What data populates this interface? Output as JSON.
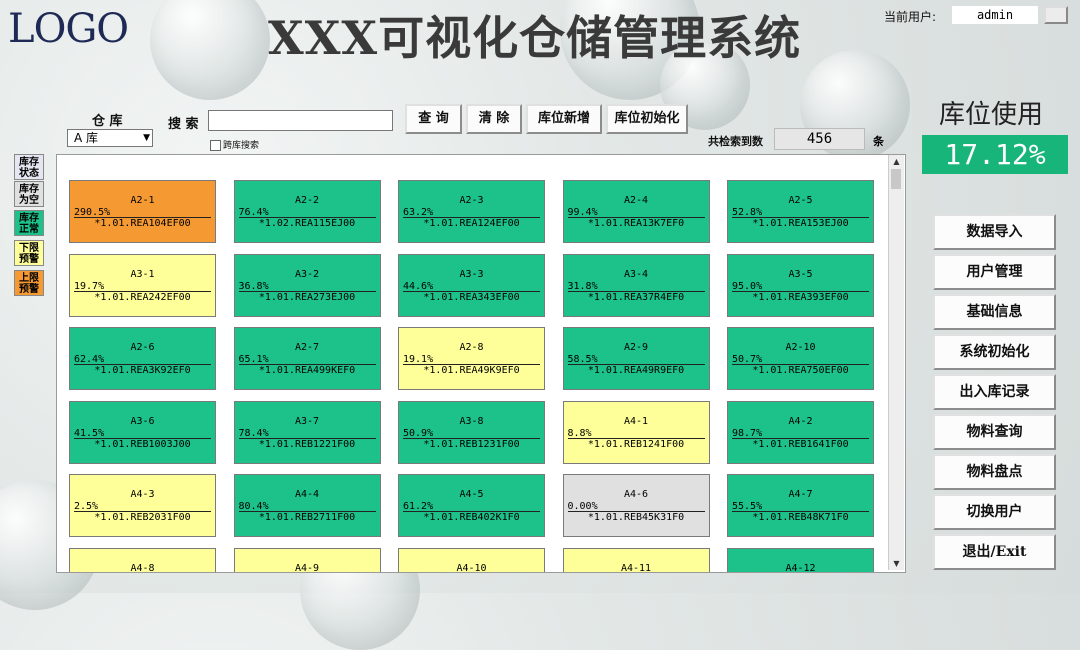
{
  "header": {
    "logo": "LOGO",
    "title": "XXX可视化仓储管理系统",
    "user_label": "当前用户:",
    "user_value": "admin"
  },
  "toolbar": {
    "warehouse_label": "仓 库",
    "warehouse_value": "A 库",
    "search_label": "搜 索",
    "search_value": "",
    "cross_search_label": "跨库搜索",
    "buttons": [
      "查 询",
      "清 除",
      "库位新增",
      "库位初始化"
    ],
    "count_label": "共检索到数",
    "count_value": "456",
    "count_unit": "条"
  },
  "usage": {
    "title": "库位使用",
    "value": "17.12%"
  },
  "legend": [
    {
      "label": "库存状态",
      "color": "#e6e6f2"
    },
    {
      "label": "库存为空",
      "color": "#e0e0e0"
    },
    {
      "label": "库存正常",
      "color": "#1cc28a"
    },
    {
      "label": "下限预警",
      "color": "#ffff99"
    },
    {
      "label": "上限预警",
      "color": "#f59a33"
    }
  ],
  "colors": {
    "normal": "#1cc28a",
    "low": "#ffff99",
    "high": "#f59a33",
    "empty": "#e0e0e0"
  },
  "cells": [
    {
      "loc": "A2-1",
      "pct": "290.5%",
      "code": "*1.01.REA104EF00",
      "status": "high"
    },
    {
      "loc": "A2-2",
      "pct": "76.4%",
      "code": "*1.02.REA115EJ00",
      "status": "normal"
    },
    {
      "loc": "A2-3",
      "pct": "63.2%",
      "code": "*1.01.REA124EF00",
      "status": "normal"
    },
    {
      "loc": "A2-4",
      "pct": "99.4%",
      "code": "*1.01.REA13K7EF0",
      "status": "normal"
    },
    {
      "loc": "A2-5",
      "pct": "52.8%",
      "code": "*1.01.REA153EJ00",
      "status": "normal"
    },
    {
      "loc": "A3-1",
      "pct": "19.7%",
      "code": "*1.01.REA242EF00",
      "status": "low"
    },
    {
      "loc": "A3-2",
      "pct": "36.8%",
      "code": "*1.01.REA273EJ00",
      "status": "normal"
    },
    {
      "loc": "A3-3",
      "pct": "44.6%",
      "code": "*1.01.REA343EF00",
      "status": "normal"
    },
    {
      "loc": "A3-4",
      "pct": "31.8%",
      "code": "*1.01.REA37R4EF0",
      "status": "normal"
    },
    {
      "loc": "A3-5",
      "pct": "95.0%",
      "code": "*1.01.REA393EF00",
      "status": "normal"
    },
    {
      "loc": "A2-6",
      "pct": "62.4%",
      "code": "*1.01.REA3K92EF0",
      "status": "normal"
    },
    {
      "loc": "A2-7",
      "pct": "65.1%",
      "code": "*1.01.REA499KEF0",
      "status": "normal"
    },
    {
      "loc": "A2-8",
      "pct": "19.1%",
      "code": "*1.01.REA49K9EF0",
      "status": "low"
    },
    {
      "loc": "A2-9",
      "pct": "58.5%",
      "code": "*1.01.REA49R9EF0",
      "status": "normal"
    },
    {
      "loc": "A2-10",
      "pct": "50.7%",
      "code": "*1.01.REA750EF00",
      "status": "normal"
    },
    {
      "loc": "A3-6",
      "pct": "41.5%",
      "code": "*1.01.REB1003J00",
      "status": "normal"
    },
    {
      "loc": "A3-7",
      "pct": "78.4%",
      "code": "*1.01.REB1221F00",
      "status": "normal"
    },
    {
      "loc": "A3-8",
      "pct": "50.9%",
      "code": "*1.01.REB1231F00",
      "status": "normal"
    },
    {
      "loc": "A4-1",
      "pct": "8.8%",
      "code": "*1.01.REB1241F00",
      "status": "low"
    },
    {
      "loc": "A4-2",
      "pct": "98.7%",
      "code": "*1.01.REB1641F00",
      "status": "normal"
    },
    {
      "loc": "A4-3",
      "pct": "2.5%",
      "code": "*1.01.REB2031F00",
      "status": "low"
    },
    {
      "loc": "A4-4",
      "pct": "80.4%",
      "code": "*1.01.REB2711F00",
      "status": "normal"
    },
    {
      "loc": "A4-5",
      "pct": "61.2%",
      "code": "*1.01.REB402K1F0",
      "status": "normal"
    },
    {
      "loc": "A4-6",
      "pct": "0.00%",
      "code": "*1.01.REB45K31F0",
      "status": "empty"
    },
    {
      "loc": "A4-7",
      "pct": "55.5%",
      "code": "*1.01.REB48K71F0",
      "status": "normal"
    },
    {
      "loc": "A4-8",
      "pct": "",
      "code": "",
      "status": "low"
    },
    {
      "loc": "A4-9",
      "pct": "",
      "code": "",
      "status": "low"
    },
    {
      "loc": "A4-10",
      "pct": "",
      "code": "",
      "status": "low"
    },
    {
      "loc": "A4-11",
      "pct": "",
      "code": "",
      "status": "low"
    },
    {
      "loc": "A4-12",
      "pct": "",
      "code": "",
      "status": "normal"
    }
  ],
  "side_menu": [
    "数据导入",
    "用户管理",
    "基础信息",
    "系统初始化",
    "出入库记录",
    "物料查询",
    "物料盘点",
    "切换用户",
    "退出/Exit"
  ]
}
